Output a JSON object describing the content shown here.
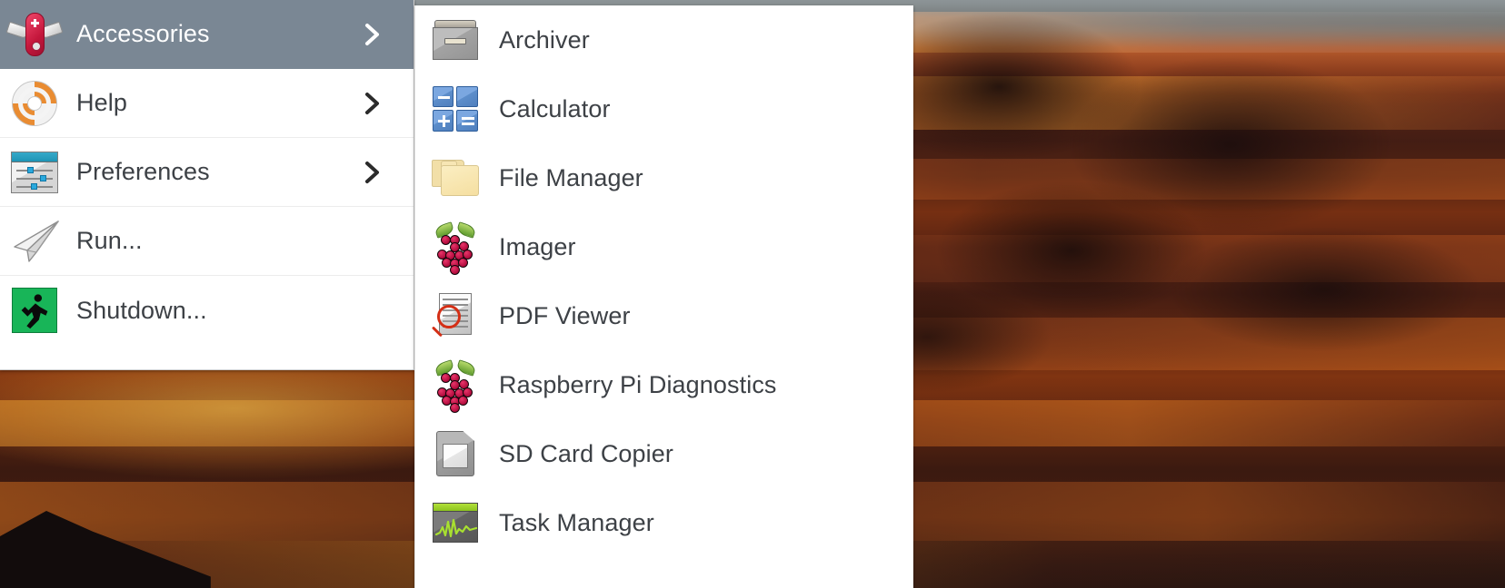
{
  "desktop": {
    "wallpaper_description": "fiery orange sunset clouds over dark hills",
    "colors": {
      "wallpaper_orange": "#d2551c",
      "wallpaper_dark": "#2a1410",
      "wallpaper_sky_gray": "#8a9296"
    }
  },
  "main_menu": {
    "name": "main-menu",
    "selected_index": 0,
    "highlight_color": "#7a8794",
    "text_color": "#3d4146",
    "background_color": "#ffffff",
    "items": [
      {
        "label": "Accessories",
        "icon": "swiss-army-knife-icon",
        "has_submenu": true,
        "selected": true
      },
      {
        "label": "Help",
        "icon": "lifebuoy-icon",
        "has_submenu": true,
        "selected": false
      },
      {
        "label": "Preferences",
        "icon": "preferences-window-icon",
        "has_submenu": true,
        "selected": false
      },
      {
        "label": "Run...",
        "icon": "paper-plane-icon",
        "has_submenu": false,
        "selected": false
      },
      {
        "label": "Shutdown...",
        "icon": "exit-running-man-icon",
        "has_submenu": false,
        "selected": false
      }
    ]
  },
  "submenu": {
    "name": "accessories-submenu",
    "parent": "Accessories",
    "text_color": "#3d4146",
    "background_color": "#ffffff",
    "items": [
      {
        "label": "Archiver",
        "icon": "archive-box-icon"
      },
      {
        "label": "Calculator",
        "icon": "calculator-icon"
      },
      {
        "label": "File Manager",
        "icon": "folders-icon"
      },
      {
        "label": "Imager",
        "icon": "raspberry-pi-icon"
      },
      {
        "label": "PDF Viewer",
        "icon": "pdf-magnifier-icon"
      },
      {
        "label": "Raspberry Pi Diagnostics",
        "icon": "raspberry-pi-icon"
      },
      {
        "label": "SD Card Copier",
        "icon": "sd-card-icon"
      },
      {
        "label": "Task Manager",
        "icon": "task-monitor-icon"
      }
    ]
  }
}
